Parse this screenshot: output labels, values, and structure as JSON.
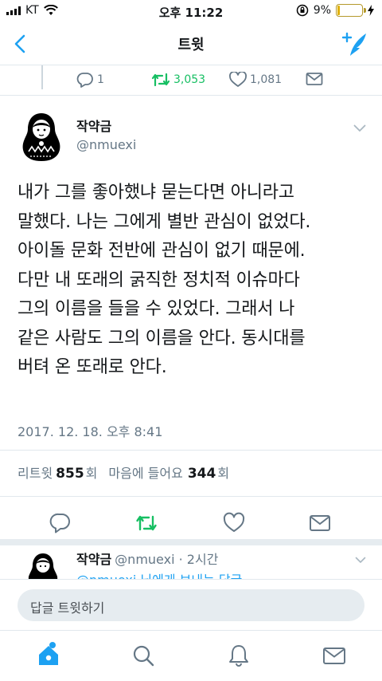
{
  "status_bar": {
    "carrier": "KT",
    "time": "오후 11:22",
    "battery_percent": "9%",
    "battery_level": 0.09
  },
  "nav": {
    "title": "트윗"
  },
  "previous_tweet": {
    "reply_count": "1",
    "retweet_count": "3,053",
    "like_count": "1,081"
  },
  "tweet": {
    "author_name": "작약금",
    "author_handle": "@nmuexi",
    "text": "내가 그를 좋아했냐 묻는다면 아니라고\n말했다. 나는 그에게 별반 관심이 없었다.\n아이돌 문화 전반에 관심이 없기 때문에.\n다만 내 또래의 굵직한 정치적 이슈마다\n그의 이름을 들을 수 있었다. 그래서 나\n같은 사람도 그의 이름을 안다. 동시대를\n버텨 온 또래로 안다.",
    "timestamp": "2017. 12. 18. 오후 8:41",
    "retweets_label": "리트윗",
    "retweets_count": "855",
    "retweets_unit": "회",
    "likes_label": "마음에 들어요",
    "likes_count": "344",
    "likes_unit": "회"
  },
  "reply": {
    "author_name": "작약금",
    "meta": "@nmuexi · 2시간",
    "text": "@nmuexi 님에게 보내는 답글"
  },
  "composer": {
    "placeholder": "답글 트윗하기"
  },
  "colors": {
    "accent": "#1da1f2",
    "retweet": "#17bf63",
    "muted": "#657786",
    "text": "#14171a"
  }
}
